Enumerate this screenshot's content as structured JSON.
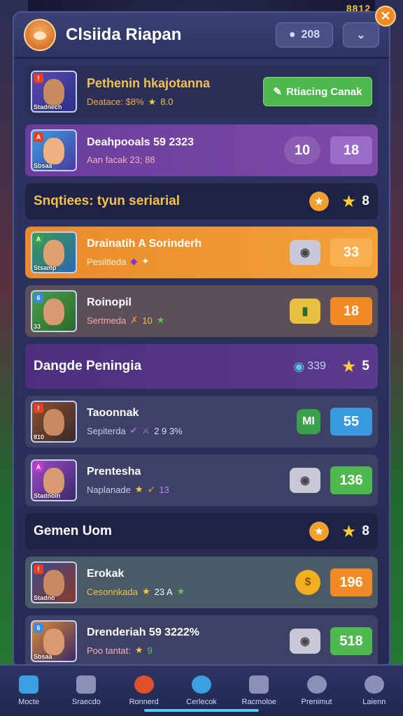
{
  "top_counter": "8812",
  "header": {
    "title": "Clsiida Riapan",
    "stat_value": "208"
  },
  "featured": {
    "name": "Pethenin hkajotanna",
    "sub_label": "Deatace: $8%",
    "rating": "8.0",
    "thumb_caption": "Stadnech",
    "action_label": "Rtiacing Canak"
  },
  "row2": {
    "name": "Deahpooals 59 2323",
    "sub": "Aan facak 23; 88",
    "pill": "10",
    "value": "18",
    "thumb_caption": "Sbsaa"
  },
  "section1": {
    "title": "Snqtiees: tyun seriarial",
    "value": "8"
  },
  "row3": {
    "name": "Drainatih A Sorinderh",
    "sub": "Pesiitleda",
    "value": "33",
    "thumb_caption": "Stsamp"
  },
  "row4": {
    "name": "Roinopil",
    "sub": "Sertmeda",
    "stat": "10",
    "value": "18",
    "thumb_caption": "33"
  },
  "section2": {
    "title": "Dangde Peningia",
    "mid": "339",
    "value": "5"
  },
  "row5": {
    "name": "Taoonnak",
    "sub": "Sepiterda",
    "stat": "2 9 3%",
    "badge": "MI",
    "value": "55",
    "thumb_caption": "810"
  },
  "row6": {
    "name": "Prentesha",
    "sub": "Naplanade",
    "stat": "13",
    "value": "136",
    "thumb_caption": "Stadnoin"
  },
  "section3": {
    "title": "Gemen Uom",
    "value": "8"
  },
  "row7": {
    "name": "Erokak",
    "sub": "Cesonnkada",
    "stat": "23 A",
    "value": "196",
    "thumb_caption": "Stadno"
  },
  "row8": {
    "name": "Drenderiah 59 3222%",
    "sub": "Poo tantat:",
    "stat": "9",
    "value": "518",
    "thumb_caption": "Sbsaa"
  },
  "nav": [
    {
      "label": "Mocte",
      "color": "#3aa0e0"
    },
    {
      "label": "Sraecdo",
      "color": "#8a90b8"
    },
    {
      "label": "Ronnerd",
      "color": "#e0502a"
    },
    {
      "label": "Cerlecok",
      "color": "#3aa0e0"
    },
    {
      "label": "Racmoloe",
      "color": "#8a90b8"
    },
    {
      "label": "Prenimut",
      "color": "#8a90b8"
    },
    {
      "label": "Laienn",
      "color": "#8a90b8"
    }
  ]
}
